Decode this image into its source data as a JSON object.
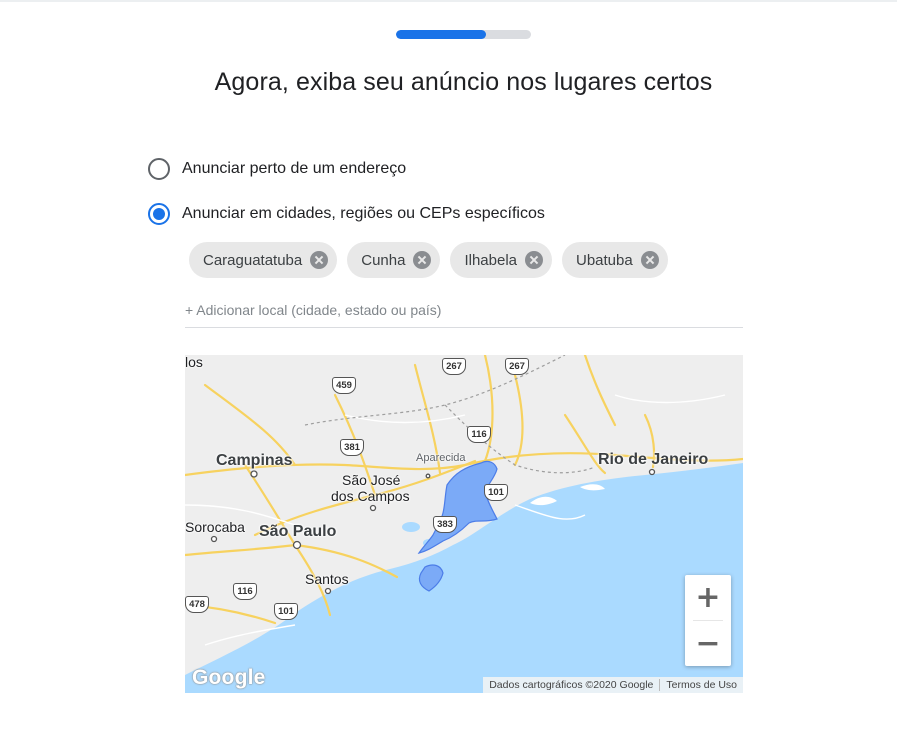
{
  "progress": {
    "fraction": 0.67
  },
  "title": "Agora, exiba seu anúncio nos lugares certos",
  "options": [
    {
      "label": "Anunciar perto de um endereço",
      "checked": false
    },
    {
      "label": "Anunciar em cidades, regiões ou CEPs específicos",
      "checked": true
    }
  ],
  "chips": [
    "Caraguatatuba",
    "Cunha",
    "Ilhabela",
    "Ubatuba"
  ],
  "add_location": {
    "placeholder": "+ Adicionar local (cidade, estado ou país)",
    "value": ""
  },
  "map": {
    "places": {
      "campinas": "Campinas",
      "sao_paulo": "São Paulo",
      "sorocaba": "Sorocaba",
      "santos": "Santos",
      "sao_jose_1": "São José",
      "sao_jose_2": "dos Campos",
      "aparecida": "Aparecida",
      "rio": "Rio de Janeiro",
      "partial_top": "los"
    },
    "roads": {
      "r267a": "267",
      "r267b": "267",
      "r459": "459",
      "r381": "381",
      "r116a": "116",
      "r101a": "101",
      "r383": "383",
      "r478": "478",
      "r116b": "116",
      "r101b": "101"
    },
    "zoom_in": "+",
    "zoom_out": "−",
    "logo": "Google",
    "attribution": {
      "data": "Dados cartográficos ©2020 Google",
      "terms": "Termos de Uso"
    }
  },
  "colors": {
    "accent": "#1a73e8",
    "land": "#eeeeee",
    "water": "#aadaff",
    "highlight": "#7baaf7"
  }
}
